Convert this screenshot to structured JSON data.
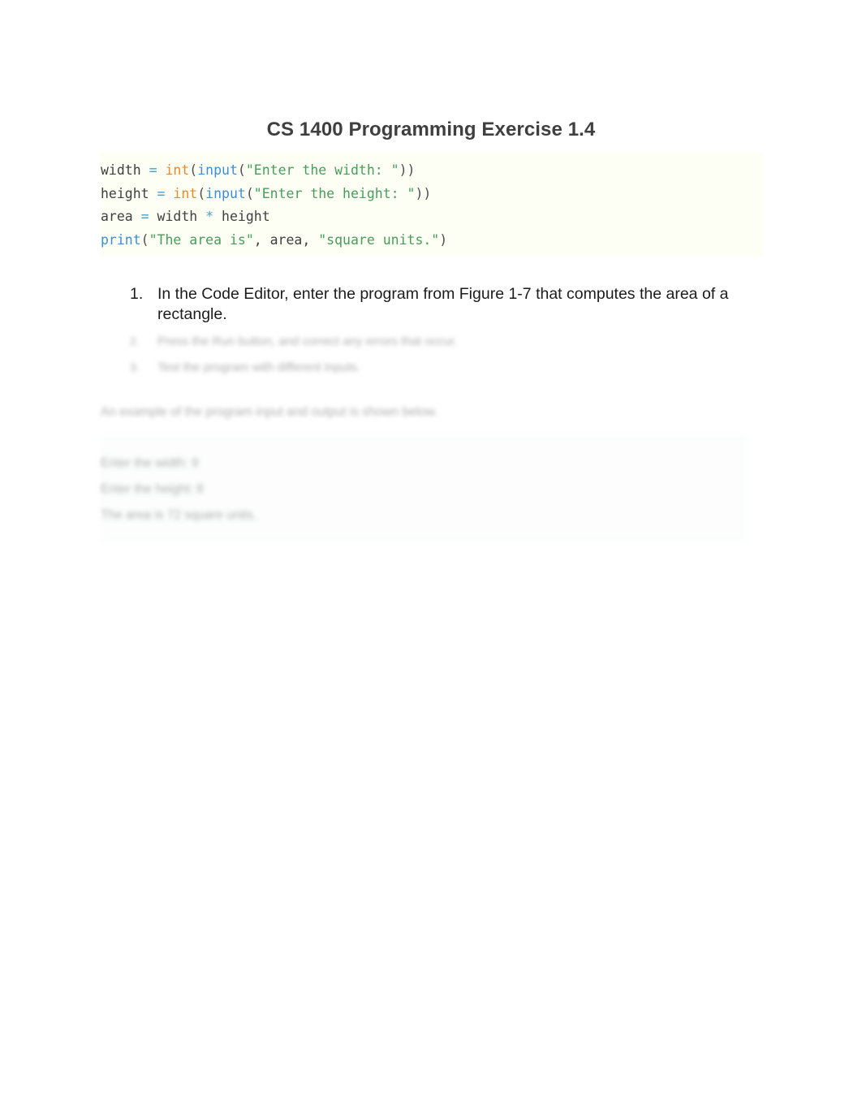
{
  "document": {
    "title": "CS 1400 Programming Exercise 1.4"
  },
  "code_block": {
    "language": "python",
    "background_color": "#fdfff5",
    "lines": [
      {
        "tokens": [
          {
            "text": "width ",
            "type": "plain"
          },
          {
            "text": "=",
            "type": "op"
          },
          {
            "text": " ",
            "type": "plain"
          },
          {
            "text": "int",
            "type": "builtin"
          },
          {
            "text": "(",
            "type": "punct"
          },
          {
            "text": "input",
            "type": "func"
          },
          {
            "text": "(",
            "type": "punct"
          },
          {
            "text": "\"Enter the width: \"",
            "type": "str"
          },
          {
            "text": "))",
            "type": "punct"
          }
        ]
      },
      {
        "tokens": [
          {
            "text": "height ",
            "type": "plain"
          },
          {
            "text": "=",
            "type": "op"
          },
          {
            "text": " ",
            "type": "plain"
          },
          {
            "text": "int",
            "type": "builtin"
          },
          {
            "text": "(",
            "type": "punct"
          },
          {
            "text": "input",
            "type": "func"
          },
          {
            "text": "(",
            "type": "punct"
          },
          {
            "text": "\"Enter the height: \"",
            "type": "str"
          },
          {
            "text": "))",
            "type": "punct"
          }
        ]
      },
      {
        "tokens": [
          {
            "text": "area ",
            "type": "plain"
          },
          {
            "text": "=",
            "type": "op"
          },
          {
            "text": " width ",
            "type": "plain"
          },
          {
            "text": "*",
            "type": "op"
          },
          {
            "text": " height",
            "type": "plain"
          }
        ]
      },
      {
        "tokens": [
          {
            "text": "print",
            "type": "func"
          },
          {
            "text": "(",
            "type": "punct"
          },
          {
            "text": "\"The area is\"",
            "type": "str"
          },
          {
            "text": ", area, ",
            "type": "plain"
          },
          {
            "text": "\"square units.\"",
            "type": "str"
          },
          {
            "text": ")",
            "type": "punct"
          }
        ]
      }
    ]
  },
  "task_list": {
    "items": [
      {
        "marker": "1.",
        "text": "In the Code Editor, enter the program from Figure 1-7 that computes the area of a rectangle.",
        "legible": true
      },
      {
        "marker": "2.",
        "text": "Press the   Run   button, and correct any errors that occur.",
        "legible": false
      },
      {
        "marker": "3.",
        "text": "Test the program with different inputs.",
        "legible": false
      }
    ]
  },
  "faded_paragraph": {
    "text": "An example of the program input and output is shown below."
  },
  "output_block": {
    "lines": [
      "Enter the width: 9",
      "Enter the height: 8",
      "The area is 72 square units."
    ]
  },
  "colors": {
    "title": "#3f3f3f",
    "code_background": "#fdfff5",
    "token_plain": "#404040",
    "token_operator": "#4d9dc4",
    "token_builtin": "#f0882b",
    "token_function": "#3f8fd0",
    "token_string": "#4a9c5c",
    "body_text": "#1c1c1c",
    "faded_text": "#8d8d8d",
    "page_background": "#ffffff"
  }
}
